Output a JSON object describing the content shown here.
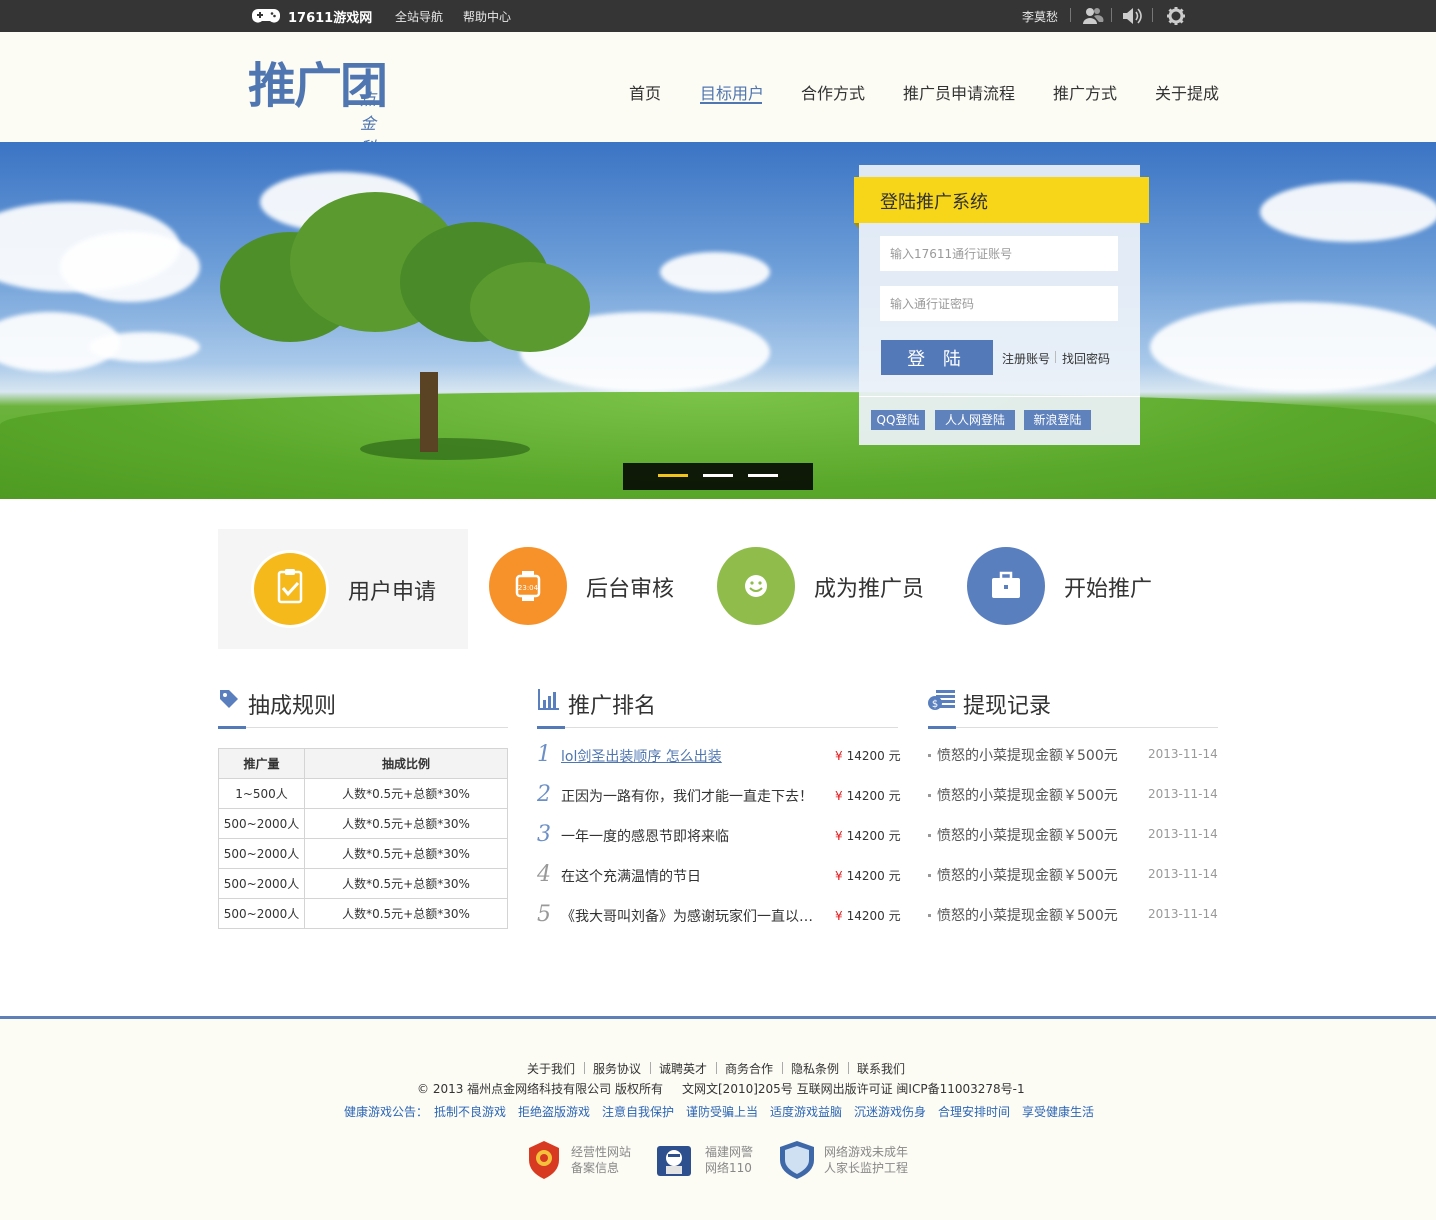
{
  "topbar": {
    "site_name": "17611游戏网",
    "links": [
      "全站导航",
      "帮助中心"
    ],
    "username": "李莫愁"
  },
  "header": {
    "logo_main": "推广团",
    "logo_sub": "点金科技",
    "nav": [
      "首页",
      "目标用户",
      "合作方式",
      "推广员申请流程",
      "推广方式",
      "关于提成"
    ],
    "active_nav": "目标用户"
  },
  "login": {
    "title": "登陆推广系统",
    "account_placeholder": "输入17611通行证账号",
    "password_placeholder": "输入通行证密码",
    "login_button": "登 陆",
    "register": "注册账号",
    "forgot": "找回密码",
    "social": [
      "QQ登陆",
      "人人网登陆",
      "新浪登陆"
    ]
  },
  "slider": {
    "count": 3,
    "active": 0
  },
  "steps": [
    {
      "label": "用户申请",
      "color": "#f6b91c",
      "icon": "clipboard-check-icon"
    },
    {
      "label": "后台审核",
      "color": "#f7922a",
      "icon": "clock-icon"
    },
    {
      "label": "成为推广员",
      "color": "#8fbc4a",
      "icon": "smile-icon"
    },
    {
      "label": "开始推广",
      "color": "#5a7fbf",
      "icon": "briefcase-icon"
    }
  ],
  "rules": {
    "title": "抽成规则",
    "headers": [
      "推广量",
      "抽成比例"
    ],
    "rows": [
      [
        "1~500人",
        "人数*0.5元+总额*30%"
      ],
      [
        "500~2000人",
        "人数*0.5元+总额*30%"
      ],
      [
        "500~2000人",
        "人数*0.5元+总额*30%"
      ],
      [
        "500~2000人",
        "人数*0.5元+总额*30%"
      ],
      [
        "500~2000人",
        "人数*0.5元+总额*30%"
      ]
    ]
  },
  "ranking": {
    "title": "推广排名",
    "items": [
      {
        "num": "1",
        "text": "lol剑圣出装顺序 怎么出装",
        "amount": "14200 元"
      },
      {
        "num": "2",
        "text": "正因为一路有你，我们才能一直走下去！",
        "amount": "14200 元"
      },
      {
        "num": "3",
        "text": "一年一度的感恩节即将来临",
        "amount": "14200 元"
      },
      {
        "num": "4",
        "text": "在这个充满温情的节日",
        "amount": "14200 元"
      },
      {
        "num": "5",
        "text": "《我大哥叫刘备》为感谢玩家们一直以来...",
        "amount": "14200 元"
      }
    ],
    "currency": "¥"
  },
  "withdrawals": {
    "title": "提现记录",
    "items": [
      {
        "text": "愤怒的小菜提现金额￥500元",
        "date": "2013-11-14"
      },
      {
        "text": "愤怒的小菜提现金额￥500元",
        "date": "2013-11-14"
      },
      {
        "text": "愤怒的小菜提现金额￥500元",
        "date": "2013-11-14"
      },
      {
        "text": "愤怒的小菜提现金额￥500元",
        "date": "2013-11-14"
      },
      {
        "text": "愤怒的小菜提现金额￥500元",
        "date": "2013-11-14"
      }
    ]
  },
  "footer": {
    "links": [
      "关于我们",
      "服务协议",
      "诚聘英才",
      "商务合作",
      "隐私条例",
      "联系我们"
    ],
    "copyright": "© 2013 福州点金网络科技有限公司 版权所有",
    "license": "文网文[2010]205号 互联网出版许可证 闽ICP备11003278号-1",
    "health_label": "健康游戏公告：",
    "health_items": [
      "抵制不良游戏",
      "拒绝盗版游戏",
      "注意自我保护",
      "谨防受骗上当",
      "适度游戏益脑",
      "沉迷游戏伤身",
      "合理安排时间",
      "享受健康生活"
    ],
    "badges": [
      {
        "line1": "经营性网站",
        "line2": "备案信息"
      },
      {
        "line1": "福建网警",
        "line2": "网络110"
      },
      {
        "line1": "网络游戏未成年",
        "line2": "人家长监护工程"
      }
    ]
  }
}
